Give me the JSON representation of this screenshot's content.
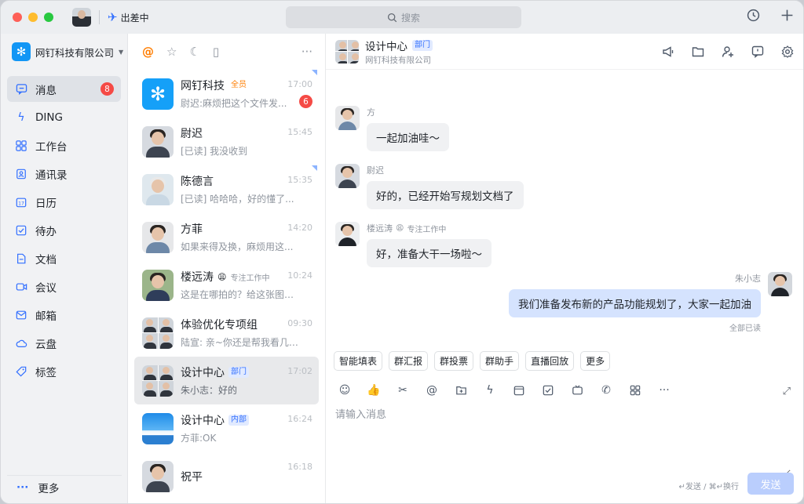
{
  "titlebar": {
    "status": "出差中",
    "search_placeholder": "搜索"
  },
  "sidebar": {
    "org_name": "网钉科技有限公司",
    "items": [
      {
        "label": "消息",
        "badge": "8",
        "icon": "message-icon"
      },
      {
        "label": "DING",
        "icon": "lightning-icon"
      },
      {
        "label": "工作台",
        "icon": "grid-icon"
      },
      {
        "label": "通讯录",
        "icon": "contacts-icon"
      },
      {
        "label": "日历",
        "icon": "calendar-icon"
      },
      {
        "label": "待办",
        "icon": "todo-icon"
      },
      {
        "label": "文档",
        "icon": "document-icon"
      },
      {
        "label": "会议",
        "icon": "video-icon"
      },
      {
        "label": "邮箱",
        "icon": "mail-icon"
      },
      {
        "label": "云盘",
        "icon": "cloud-icon"
      },
      {
        "label": "标签",
        "icon": "tag-icon"
      }
    ],
    "more_label": "更多"
  },
  "convlist": {
    "conversations": [
      {
        "name": "网钉科技",
        "tag": "全员",
        "time": "17:00",
        "msg": "尉迟:麻烦把这个文件发...",
        "unread": "6"
      },
      {
        "name": "尉迟",
        "time": "15:45",
        "msg": "[已读] 我没收到"
      },
      {
        "name": "陈德言",
        "time": "15:35",
        "msg": "[已读] 哈哈哈，好的懂了..."
      },
      {
        "name": "方菲",
        "time": "14:20",
        "msg": "如果来得及换，麻烦用这..."
      },
      {
        "name": "楼远涛",
        "status": "专注工作中",
        "time": "10:24",
        "msg": "这是在哪拍的？给这张图片..."
      },
      {
        "name": "体验优化专项组",
        "time": "09:30",
        "msg": "陆宣: 亲~你还是帮我看几张..."
      },
      {
        "name": "设计中心",
        "tag": "部门",
        "time": "17:02",
        "msg": "朱小志：好的"
      },
      {
        "name": "设计中心",
        "tag": "内部",
        "time": "16:24",
        "msg": "方菲:OK"
      },
      {
        "name": "祝平",
        "time": "16:18",
        "msg": ""
      }
    ]
  },
  "chat": {
    "title": "设计中心",
    "tag": "部门",
    "subtitle": "网钉科技有限公司",
    "messages": [
      {
        "sender": "方",
        "text": "一起加油哇～"
      },
      {
        "sender": "尉迟",
        "text": "好的，已经开始写规划文档了"
      },
      {
        "sender": "楼远涛",
        "status": "专注工作中",
        "text": "好，准备大干一场啦～"
      },
      {
        "sender": "朱小志",
        "text": "我们准备发布新的产品功能规划了，大家一起加油",
        "read": "全部已读"
      }
    ],
    "quick_actions": [
      "智能填表",
      "群汇报",
      "群投票",
      "群助手",
      "直播回放",
      "更多"
    ],
    "input_placeholder": "请输入消息",
    "hint": "↵发送 / ⌘↵换行",
    "send_label": "发送"
  },
  "colors": {
    "accent": "#3370ff",
    "badge": "#f54a45",
    "my_bubble": "#d5e3fe"
  }
}
